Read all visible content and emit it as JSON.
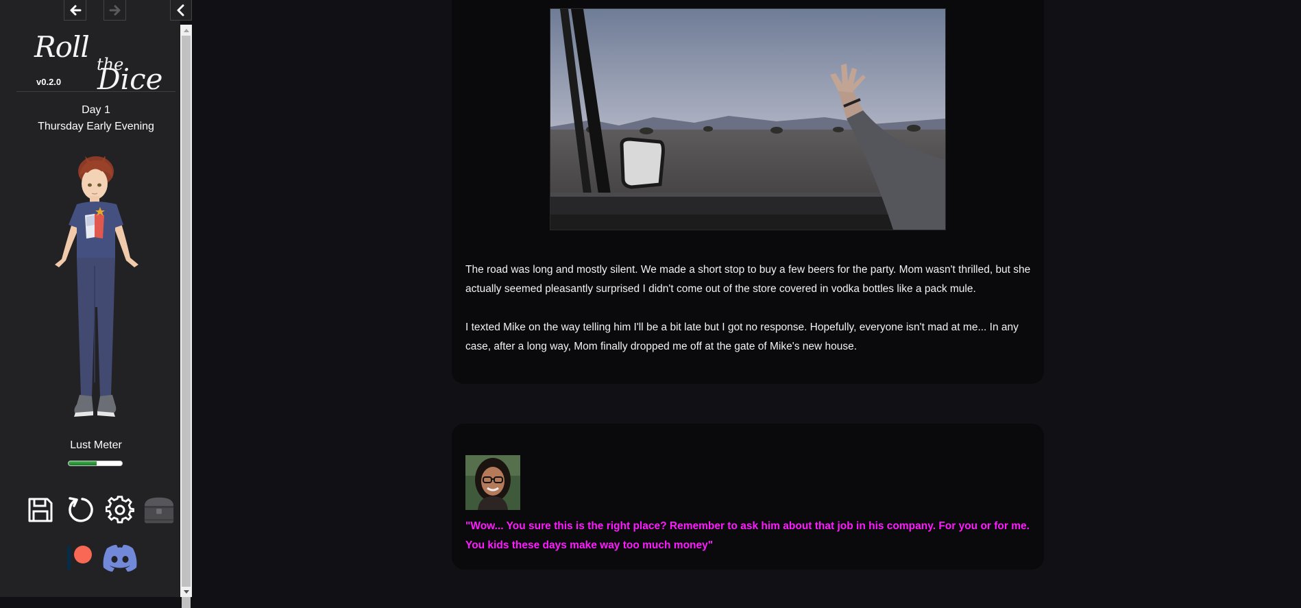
{
  "sidebar": {
    "title": {
      "roll": "Roll",
      "the": "the",
      "dice": "Dice"
    },
    "version": "v0.2.0",
    "day": "Day 1",
    "time": "Thursday Early Evening",
    "lust_meter": {
      "label": "Lust Meter",
      "level_percent": 52
    },
    "icons": {
      "back": "arrow-left-icon",
      "forward": "arrow-right-icon",
      "collapse": "chevron-left-icon",
      "save": "save-icon",
      "restart": "restart-icon",
      "settings": "gear-icon",
      "inventory": "chest-icon",
      "patreon": "patreon-icon",
      "discord": "discord-icon"
    }
  },
  "story": {
    "paragraphs": [
      "The road was long and mostly silent. We made a short stop to buy a few beers for the party. Mom wasn't thrilled, but she actually seemed pleasantly surprised I didn't come out of the store covered in vodka bottles like a pack mule.",
      "I texted Mike on the way telling him I'll be a bit late but I got no response. Hopefully, everyone isn't mad at me... In any case, after a long way, Mom finally dropped me off at the gate of Mike's new house."
    ],
    "dialogue": "\"Wow... You sure this is the right place? Remember to ask him about that job in his company. For you or for me. You kids these days make way too much money\""
  },
  "colors": {
    "background": "#111014",
    "sidebar": "#222124",
    "passage": "#0a090c",
    "dialogue": "#ff1bff",
    "lust_fill": "#2e9e3c"
  }
}
